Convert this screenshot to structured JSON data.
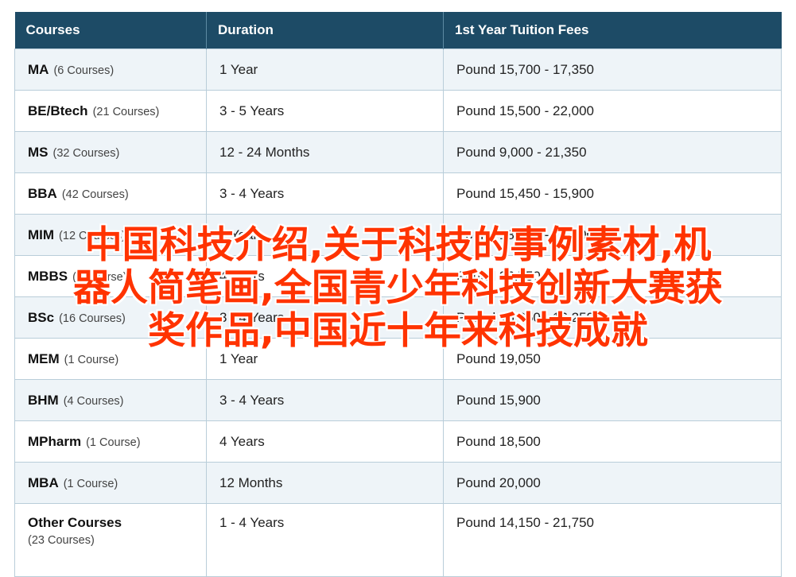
{
  "table": {
    "headers": [
      "Courses",
      "Duration",
      "1st Year Tuition Fees"
    ],
    "rows": [
      {
        "course": "MA",
        "count": "(6 Courses)",
        "duration": "1 Year",
        "fees": "Pound 15,700 - 17,350"
      },
      {
        "course": "BE/Btech",
        "count": "(21 Courses)",
        "duration": "3 - 5 Years",
        "fees": "Pound 15,500 - 22,000"
      },
      {
        "course": "MS",
        "count": "(32 Courses)",
        "duration": "12 - 24 Months",
        "fees": "Pound 9,000 - 21,350"
      },
      {
        "course": "BBA",
        "count": "(42 Courses)",
        "duration": "3 - 4 Years",
        "fees": "Pound 15,450 - 15,900"
      },
      {
        "course": "MIM",
        "count": "(12 Courses)",
        "duration": "1 Year",
        "fees": "Pound 18,100 - 18,900"
      },
      {
        "course": "MBBS",
        "count": "(1 Course)",
        "duration": "4 Years",
        "fees": "Pound 36,750"
      },
      {
        "course": "BSc",
        "count": "(16 Courses)",
        "duration": "3 - 4 Years",
        "fees": "Pound 15,850 - 16,250"
      },
      {
        "course": "MEM",
        "count": "(1 Course)",
        "duration": "1 Year",
        "fees": "Pound 19,050"
      },
      {
        "course": "BHM",
        "count": "(4 Courses)",
        "duration": "3 - 4 Years",
        "fees": "Pound 15,900"
      },
      {
        "course": "MPharm",
        "count": "(1 Course)",
        "duration": "4 Years",
        "fees": "Pound 18,500"
      },
      {
        "course": "MBA",
        "count": "(1 Course)",
        "duration": "12 Months",
        "fees": "Pound 20,000"
      },
      {
        "course": "Other Courses",
        "count": "(23 Courses)",
        "duration": "1 - 4 Years",
        "fees": "Pound 14,150 - 21,750"
      }
    ]
  },
  "overlay": {
    "lines": [
      "中国科技介绍,关于科技的事例素材,机",
      "器人简笔画,全国青少年科技创新大赛获",
      "奖作品,中国近十年来科技成就"
    ],
    "color": "#ff3300"
  },
  "colors": {
    "header_bg": "#1d4b66",
    "row_alt_bg": "#eef4f8",
    "border": "#b9cdd9"
  }
}
